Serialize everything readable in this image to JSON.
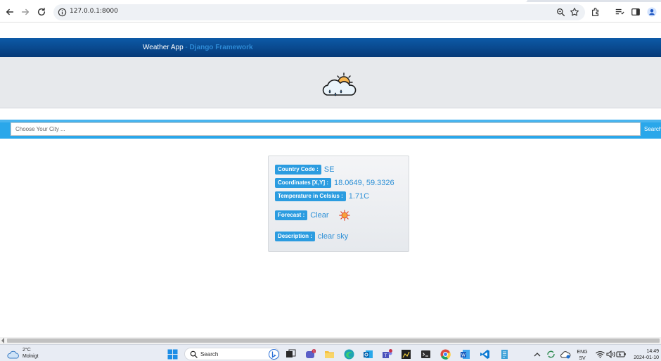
{
  "browser": {
    "url": "127.0.0.1:8000"
  },
  "navbar": {
    "app_name": "Weather App",
    "separator": " - ",
    "framework": "Django Framework"
  },
  "search": {
    "placeholder": "Choose Your City ...",
    "button_label": "Search"
  },
  "weather": {
    "country_code_label": "Country Code :",
    "country_code": "SE",
    "coordinates_label": "Coordinates [X,Y] :",
    "coordinates": "18.0649, 59.3326",
    "temperature_label": "Temperature in Celsius :",
    "temperature": "1.71C",
    "forecast_label": "Forecast :",
    "forecast": "Clear",
    "forecast_icon": "sun-icon",
    "description_label": "Description :",
    "description": "clear sky"
  },
  "taskbar": {
    "weather_temp": "2°C",
    "weather_condition": "Molnigt",
    "search_label": "Search",
    "teams_badge": "1",
    "teams2_badge": "1",
    "language": "ENG",
    "layout": "SV",
    "time": "14:49",
    "date": "2024-01-10"
  }
}
